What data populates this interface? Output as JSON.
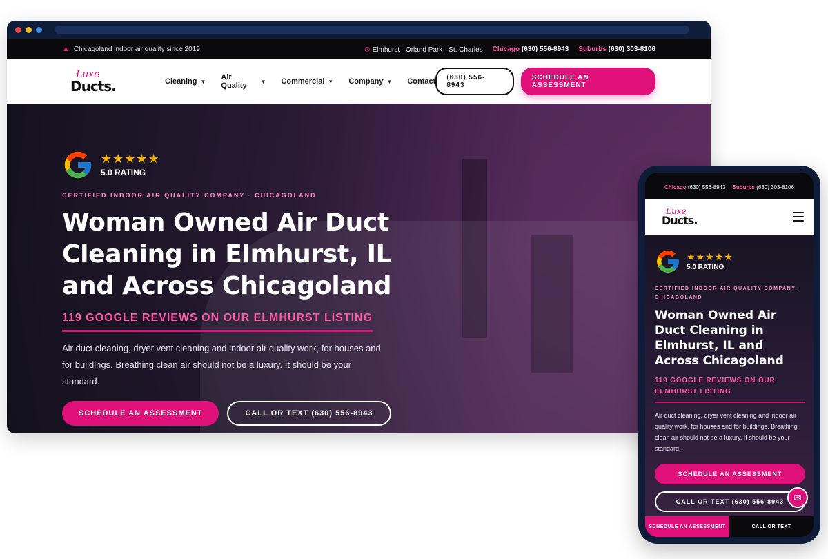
{
  "desktop": {
    "topbar": {
      "tagline": "Chicagoland indoor air quality since 2019",
      "locations": "Elmhurst · Orland Park · St. Charles",
      "chicago_label": "Chicago",
      "chicago_phone": "(630) 556-8943",
      "suburbs_label": "Suburbs",
      "suburbs_phone": "(630) 303-8106"
    },
    "logo": {
      "line1": "Luxe",
      "line2": "Ducts."
    },
    "nav": {
      "items": [
        {
          "label": "Cleaning",
          "has_dropdown": true
        },
        {
          "label": "Air Quality",
          "has_dropdown": true
        },
        {
          "label": "Commercial",
          "has_dropdown": true
        },
        {
          "label": "Company",
          "has_dropdown": true
        },
        {
          "label": "Contact",
          "has_dropdown": false
        }
      ],
      "phone_button": "(630) 556-8943",
      "cta_button": "SCHEDULE AN ASSESSMENT"
    },
    "hero": {
      "rating_value": "5.0 RATING",
      "stars": "★★★★★",
      "eyebrow": "CERTIFIED INDOOR AIR QUALITY COMPANY · CHICAGOLAND",
      "headline_line1": "Woman Owned Air Duct",
      "headline_line2": "Cleaning in Elmhurst, IL",
      "headline_line3": "and Across Chicagoland",
      "reviews": "119 GOOGLE REVIEWS ON OUR ELMHURST LISTING",
      "body_line1": "Air duct cleaning, dryer vent cleaning and indoor air quality work, for houses and",
      "body_line2": "for buildings. Breathing clean air should not be a luxury. It should be your",
      "body_line3": "standard.",
      "cta_primary": "SCHEDULE AN ASSESSMENT",
      "cta_secondary": "CALL OR TEXT (630) 556-8943"
    }
  },
  "mobile": {
    "topbar": {
      "chicago_label": "Chicago",
      "chicago_phone": "(630) 556-8943",
      "suburbs_label": "Suburbs",
      "suburbs_phone": "(630) 303-8106"
    },
    "hero": {
      "stars": "★★★★★",
      "rating_value": "5.0 RATING",
      "eyebrow": "CERTIFIED INDOOR AIR QUALITY COMPANY · CHICAGOLAND",
      "headline": "Woman Owned Air Duct Cleaning in Elmhurst, IL and Across Chicagoland",
      "reviews": "119 GOOGLE REVIEWS ON OUR ELMHURST LISTING",
      "body": "Air duct cleaning, dryer vent cleaning and indoor air quality work, for houses and for buildings. Breathing clean air should not be a luxury. It should be your standard.",
      "cta_primary": "SCHEDULE AN ASSESSMENT",
      "cta_secondary": "CALL OR TEXT (630) 556-8943"
    },
    "bottom_bar": {
      "left": "SCHEDULE AN ASSESSMENT",
      "right": "CALL OR TEXT"
    }
  },
  "colors": {
    "brand_pink": "#e0107a",
    "accent_pink_text": "#ff5aa8",
    "star_gold": "#f5b300",
    "dark_bar": "#0a0a0c",
    "frame_navy": "#0e1c3a"
  }
}
